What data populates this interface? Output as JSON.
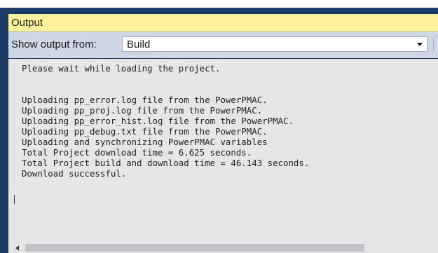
{
  "panel": {
    "title": "Output"
  },
  "toolbar": {
    "show_output_label": "Show output from:",
    "source_selected": "Build",
    "clear_icon": "wrap-or-clear-icon"
  },
  "output": {
    "text": "Please wait while loading the project.\n\n\nUploading pp_error.log file from the PowerPMAC.\nUploading pp_proj.log file from the PowerPMAC.\nUploading pp_error_hist.log file from the PowerPMAC.\nUploading pp_debug.txt file from the PowerPMAC.\nUploading and synchronizing PowerPMAC variables\nTotal Project download time = 6.625 seconds.\nTotal Project build and download time = 46.143 seconds.\nDownload successful."
  },
  "colors": {
    "title_bar": "#fff29d",
    "toolbar": "#cfd6e5",
    "output_bg": "#e6e6e6",
    "frame": "#1c3a66"
  }
}
